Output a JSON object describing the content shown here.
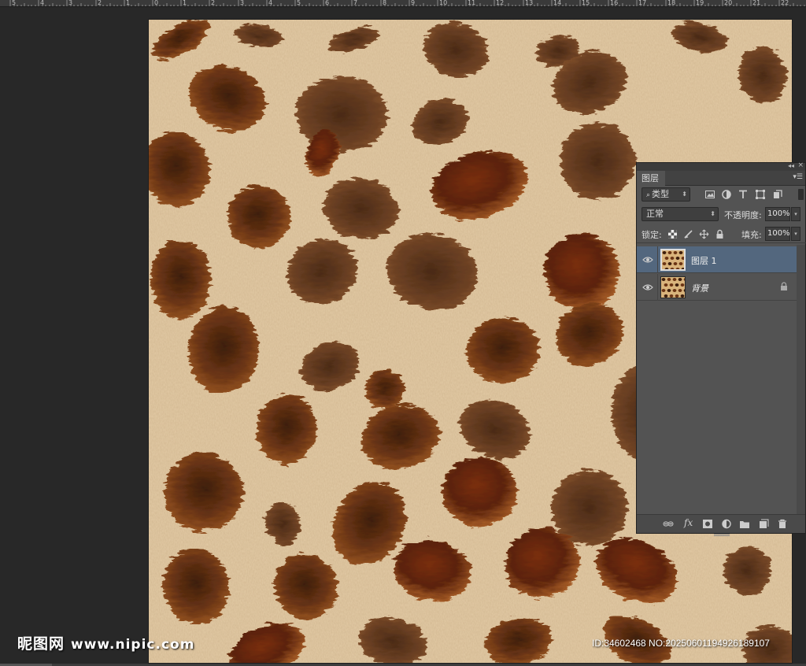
{
  "ruler": {
    "labels": [
      "5",
      "4",
      "3",
      "2",
      "1",
      "0",
      "1",
      "2",
      "3",
      "4",
      "5",
      "6",
      "7",
      "8",
      "9",
      "10",
      "11",
      "12",
      "13",
      "14",
      "15",
      "16",
      "17",
      "18",
      "19",
      "20",
      "21",
      "22",
      "23"
    ]
  },
  "canvas": {
    "content": "leopard-fur-texture",
    "colors": {
      "fur_light": "#e2c9a3",
      "spot_dark": "#5a2e12",
      "spot_mid": "#8b4a1c",
      "spot_warm": "#a35a22"
    }
  },
  "layers_panel": {
    "tab_label": "图层",
    "filter": {
      "kind_label": "类型",
      "icons": [
        "image-filter-icon",
        "adjustment-filter-icon",
        "type-filter-icon",
        "shape-filter-icon",
        "smart-object-filter-icon"
      ]
    },
    "blend_mode": "正常",
    "opacity_label": "不透明度:",
    "opacity_value": "100%",
    "lock_label": "锁定:",
    "fill_label": "填充:",
    "fill_value": "100%",
    "layers": [
      {
        "name": "图层 1",
        "selected": true,
        "visible": true,
        "locked": false
      },
      {
        "name": "背景",
        "selected": false,
        "visible": true,
        "locked": true
      }
    ],
    "footer_fx": "fx"
  },
  "watermark": {
    "logo_text": "昵图网",
    "site_text": "www.nipic.com",
    "id_text": "ID:34602468 NO:20250601194926189107"
  }
}
